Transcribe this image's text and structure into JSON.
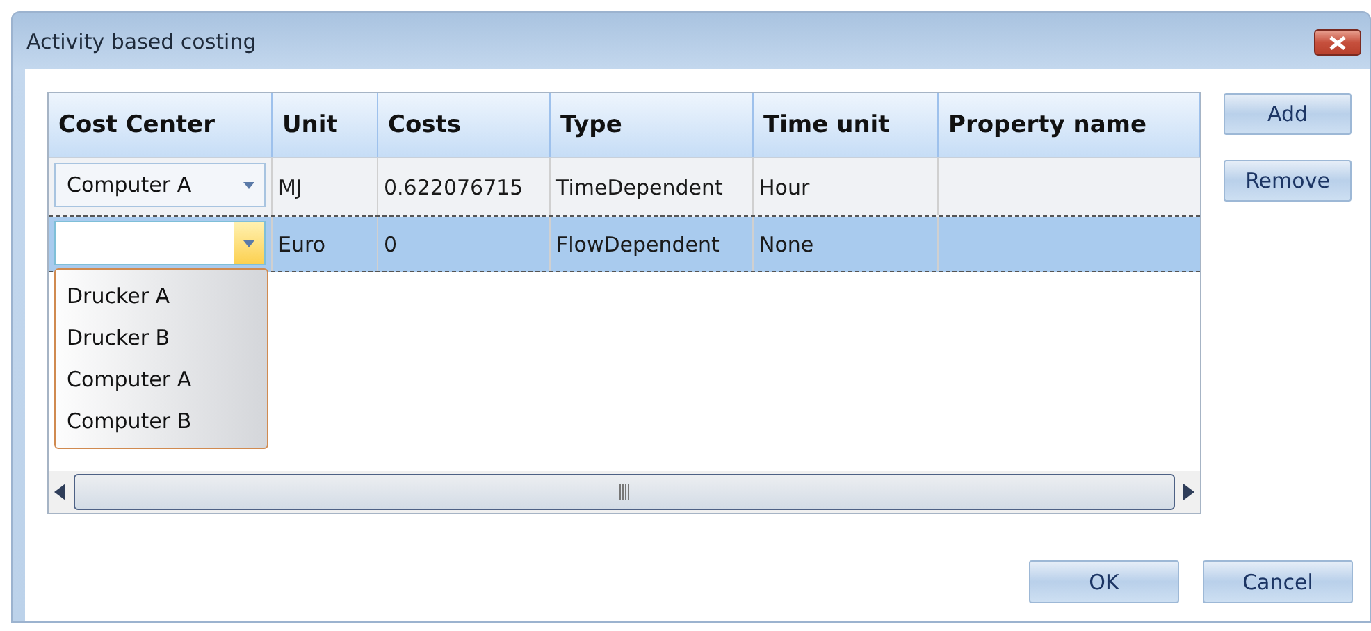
{
  "window": {
    "title": "Activity based costing"
  },
  "table": {
    "columns": [
      "Cost Center",
      "Unit",
      "Costs",
      "Type",
      "Time unit",
      "Property name"
    ],
    "rows": [
      {
        "selected": false,
        "cells": [
          {
            "kind": "combo",
            "value": "Computer A",
            "expanded": false
          },
          {
            "kind": "text",
            "text": "MJ"
          },
          {
            "kind": "text",
            "text": "0.622076715"
          },
          {
            "kind": "text",
            "text": "TimeDependent"
          },
          {
            "kind": "text",
            "text": "Hour"
          }
        ]
      },
      {
        "selected": true,
        "cells": [
          {
            "kind": "combo",
            "expanded": true
          },
          {
            "kind": "text",
            "text": "Euro"
          },
          {
            "kind": "text",
            "text": "0"
          },
          {
            "kind": "text",
            "text": "FlowDependent"
          },
          {
            "kind": "text",
            "text": "None"
          }
        ]
      }
    ]
  },
  "dropdown": {
    "options": [
      "Drucker A",
      "Drucker B",
      "Computer A",
      "Computer B"
    ]
  },
  "side_buttons": [
    "Add",
    "Remove"
  ],
  "footer_buttons": [
    "OK",
    "Cancel"
  ]
}
